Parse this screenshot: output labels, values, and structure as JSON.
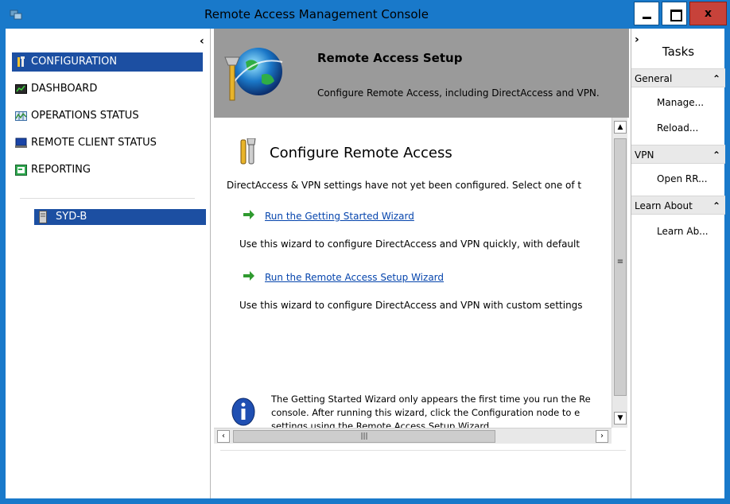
{
  "window": {
    "title": "Remote Access Management Console",
    "close_label": "x"
  },
  "nav": {
    "collapse_glyph": "‹",
    "items": [
      {
        "label": "CONFIGURATION",
        "icon": "configuration-icon"
      },
      {
        "label": "DASHBOARD",
        "icon": "dashboard-icon"
      },
      {
        "label": "OPERATIONS STATUS",
        "icon": "operations-status-icon"
      },
      {
        "label": "REMOTE CLIENT STATUS",
        "icon": "remote-client-status-icon"
      },
      {
        "label": "REPORTING",
        "icon": "reporting-icon"
      }
    ],
    "server": "SYD-B"
  },
  "banner": {
    "title": "Remote Access Setup",
    "subtitle": "Configure Remote Access, including DirectAccess and VPN."
  },
  "main": {
    "heading": "Configure Remote Access",
    "description": "DirectAccess & VPN settings have not yet been configured. Select one of t",
    "wizards": [
      {
        "link": "Run the Getting Started Wizard",
        "desc": "Use this wizard to configure DirectAccess and VPN quickly, with default"
      },
      {
        "link": "Run the Remote Access Setup Wizard",
        "desc": "Use this wizard to configure DirectAccess and VPN with custom settings"
      }
    ],
    "info_line1": "The Getting Started Wizard only appears the first time you run the Re",
    "info_line2": "console. After running this wizard, click the Configuration node to e",
    "info_line3": "settings using the Remote Access Setup Wizard."
  },
  "tasks": {
    "expand_glyph": "›",
    "title": "Tasks",
    "groups": [
      {
        "label": "General",
        "items": [
          "Manage...",
          "Reload..."
        ]
      },
      {
        "label": "VPN",
        "items": [
          "Open RR..."
        ]
      },
      {
        "label": "Learn About",
        "items": [
          "Learn Ab..."
        ]
      }
    ]
  },
  "colors": {
    "titlebar": "#1979ca",
    "selection": "#1c4fa2",
    "banner": "#9a9a9a",
    "link": "#0645ad"
  }
}
